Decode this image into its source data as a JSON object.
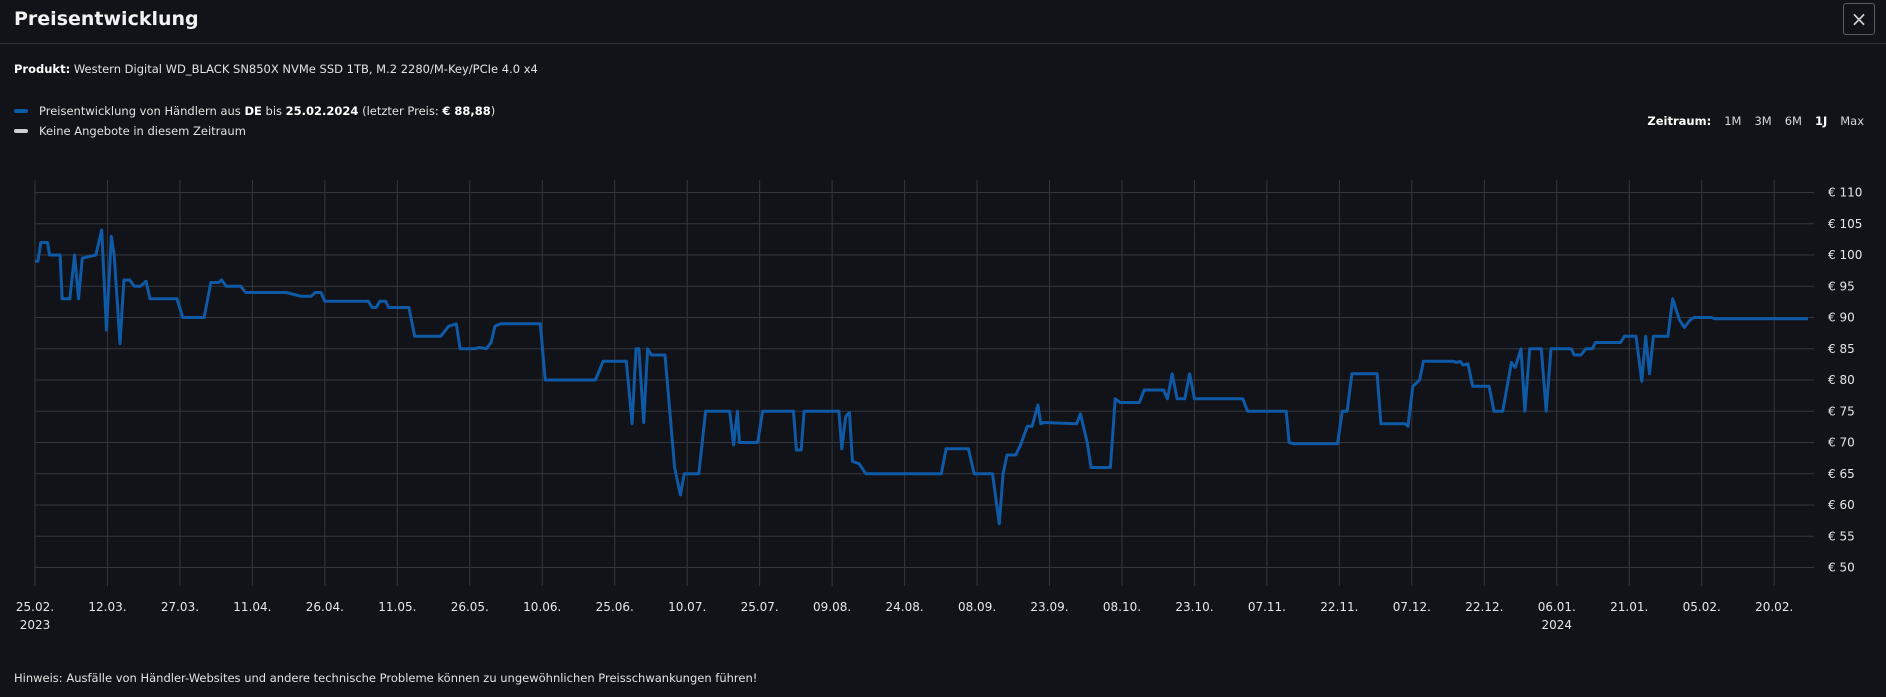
{
  "header": {
    "title": "Preisentwicklung",
    "close_icon": "×"
  },
  "product": {
    "label": "Produkt:",
    "name": "Western Digital WD_BLACK SN850X NVMe SSD 1TB, M.2 2280/M-Key/PCIe 4.0 x4"
  },
  "legend": {
    "text1": "Preisentwicklung von Händlern aus ",
    "country": "DE",
    "text2": " bis ",
    "date": "25.02.2024",
    "text3": " (letzter Preis: ",
    "last_price": "€ 88,88",
    "text4": ")",
    "no_offers": "Keine Angebote in diesem Zeitraum"
  },
  "range": {
    "label": "Zeitraum:",
    "options": [
      "1M",
      "3M",
      "6M",
      "1J",
      "Max"
    ],
    "active": "1J"
  },
  "note": "Hinweis: Ausfälle von Händler-Websites und andere technische Probleme können zu ungewöhnlichen Preisschwankungen führen!",
  "colors": {
    "line": "#0e5aa7",
    "no_offers": "#d0d0d0",
    "background": "#111318",
    "grid": "#34373e"
  },
  "chart_data": {
    "type": "line",
    "title": "",
    "xlabel": "",
    "ylabel": "",
    "ylim": [
      48,
      112
    ],
    "y_ticks": [
      110,
      105,
      100,
      95,
      90,
      85,
      80,
      75,
      70,
      65,
      60,
      55,
      50
    ],
    "y_tick_labels": [
      "€ 110",
      "€ 105",
      "€ 100",
      "€ 95",
      "€ 90",
      "€ 85",
      "€ 80",
      "€ 75",
      "€ 70",
      "€ 65",
      "€ 60",
      "€ 55",
      "€ 50"
    ],
    "x_range": [
      0,
      367
    ],
    "x_ticks": [
      {
        "day": 0,
        "label": "25.02.",
        "sub": "2023"
      },
      {
        "day": 15,
        "label": "12.03."
      },
      {
        "day": 30,
        "label": "27.03."
      },
      {
        "day": 45,
        "label": "11.04."
      },
      {
        "day": 60,
        "label": "26.04."
      },
      {
        "day": 75,
        "label": "11.05."
      },
      {
        "day": 90,
        "label": "26.05."
      },
      {
        "day": 105,
        "label": "10.06."
      },
      {
        "day": 120,
        "label": "25.06."
      },
      {
        "day": 135,
        "label": "10.07."
      },
      {
        "day": 150,
        "label": "25.07."
      },
      {
        "day": 165,
        "label": "09.08."
      },
      {
        "day": 180,
        "label": "24.08."
      },
      {
        "day": 195,
        "label": "08.09."
      },
      {
        "day": 210,
        "label": "23.09."
      },
      {
        "day": 225,
        "label": "08.10."
      },
      {
        "day": 240,
        "label": "23.10."
      },
      {
        "day": 255,
        "label": "07.11."
      },
      {
        "day": 270,
        "label": "22.11."
      },
      {
        "day": 285,
        "label": "07.12."
      },
      {
        "day": 300,
        "label": "22.12."
      },
      {
        "day": 315,
        "label": "06.01.",
        "sub": "2024"
      },
      {
        "day": 330,
        "label": "21.01."
      },
      {
        "day": 345,
        "label": "05.02."
      },
      {
        "day": 360,
        "label": "20.02."
      }
    ],
    "series": [
      {
        "values": [
          [
            0,
            99
          ],
          [
            0.6,
            99
          ],
          [
            1.2,
            102
          ],
          [
            2.6,
            102
          ],
          [
            3,
            100
          ],
          [
            5.2,
            100
          ],
          [
            5.6,
            93
          ],
          [
            7.2,
            93
          ],
          [
            8.2,
            100
          ],
          [
            9,
            93
          ],
          [
            9.8,
            99.5
          ],
          [
            12.6,
            100
          ],
          [
            13.8,
            104
          ],
          [
            14.8,
            88
          ],
          [
            15.8,
            103
          ],
          [
            16.4,
            100
          ],
          [
            17.6,
            85.8
          ],
          [
            18.4,
            96
          ],
          [
            19.6,
            96
          ],
          [
            20.6,
            95
          ],
          [
            21.8,
            95
          ],
          [
            23,
            95.8
          ],
          [
            23.8,
            93
          ],
          [
            29.4,
            93
          ],
          [
            30.6,
            90
          ],
          [
            35,
            90
          ],
          [
            36.4,
            95.6
          ],
          [
            38,
            95.6
          ],
          [
            38.6,
            96
          ],
          [
            39.6,
            95
          ],
          [
            42.6,
            95
          ],
          [
            43.6,
            94
          ],
          [
            52,
            94
          ],
          [
            55,
            93.4
          ],
          [
            57.2,
            93.4
          ],
          [
            58,
            94
          ],
          [
            59.2,
            94
          ],
          [
            60,
            92.6
          ],
          [
            69,
            92.6
          ],
          [
            69.8,
            91.6
          ],
          [
            70.6,
            91.6
          ],
          [
            71.4,
            92.6
          ],
          [
            72.6,
            92.6
          ],
          [
            73.2,
            91.6
          ],
          [
            77.4,
            91.6
          ],
          [
            78.6,
            87
          ],
          [
            84,
            87
          ],
          [
            85.6,
            88.6
          ],
          [
            87.2,
            89
          ],
          [
            88,
            85
          ],
          [
            91,
            85
          ],
          [
            92,
            85.2
          ],
          [
            93.4,
            85
          ],
          [
            94.4,
            86
          ],
          [
            95.2,
            88.6
          ],
          [
            96.4,
            89
          ],
          [
            104.6,
            89
          ],
          [
            105.6,
            80
          ],
          [
            116,
            80
          ],
          [
            117.6,
            83
          ],
          [
            122.4,
            83
          ],
          [
            123.6,
            73
          ],
          [
            124.4,
            85
          ],
          [
            125,
            85
          ],
          [
            126,
            73.2
          ],
          [
            126.8,
            85
          ],
          [
            127.6,
            84
          ],
          [
            130.4,
            84
          ],
          [
            132.4,
            66
          ],
          [
            133.6,
            61.6
          ],
          [
            134.4,
            65
          ],
          [
            137.4,
            65
          ],
          [
            138.8,
            75
          ],
          [
            143.8,
            75
          ],
          [
            144.6,
            69.6
          ],
          [
            145.4,
            75
          ],
          [
            145.8,
            70
          ],
          [
            149.6,
            70
          ],
          [
            150.6,
            75
          ],
          [
            157,
            75
          ],
          [
            157.6,
            68.8
          ],
          [
            158.6,
            68.8
          ],
          [
            159.2,
            75
          ],
          [
            166.4,
            75
          ],
          [
            167,
            69
          ],
          [
            167.8,
            74.2
          ],
          [
            168.6,
            74.8
          ],
          [
            169.2,
            67
          ],
          [
            170.6,
            66.6
          ],
          [
            172,
            65
          ],
          [
            187.6,
            65
          ],
          [
            188.6,
            69
          ],
          [
            193.2,
            69
          ],
          [
            194.4,
            65
          ],
          [
            198.2,
            65
          ],
          [
            199.6,
            57
          ],
          [
            200.4,
            65
          ],
          [
            201.2,
            68
          ],
          [
            203,
            68
          ],
          [
            204,
            69.6
          ],
          [
            205.4,
            72.6
          ],
          [
            206.4,
            72.6
          ],
          [
            207.6,
            76
          ],
          [
            208.2,
            73
          ],
          [
            208.8,
            73.2
          ],
          [
            215.6,
            73
          ],
          [
            216.4,
            74.6
          ],
          [
            217.8,
            70
          ],
          [
            218.6,
            66
          ],
          [
            222.6,
            66
          ],
          [
            223.6,
            77
          ],
          [
            224.6,
            76.4
          ],
          [
            228.6,
            76.4
          ],
          [
            229.6,
            78.4
          ],
          [
            233.6,
            78.4
          ],
          [
            234.4,
            77
          ],
          [
            235.4,
            81
          ],
          [
            236.4,
            77
          ],
          [
            238,
            77
          ],
          [
            239,
            81
          ],
          [
            240,
            77
          ],
          [
            250,
            77
          ],
          [
            251,
            75
          ],
          [
            259,
            75
          ],
          [
            259.6,
            70
          ],
          [
            260.6,
            69.8
          ],
          [
            269.6,
            69.8
          ],
          [
            270.6,
            75
          ],
          [
            271.6,
            75
          ],
          [
            272.6,
            81
          ],
          [
            277.8,
            81
          ],
          [
            278.6,
            73
          ],
          [
            283.6,
            73
          ],
          [
            284.2,
            72.6
          ],
          [
            285.2,
            79
          ],
          [
            286.6,
            80
          ],
          [
            287.4,
            83
          ],
          [
            293.6,
            83
          ],
          [
            294.2,
            82.8
          ],
          [
            295,
            83
          ],
          [
            295.6,
            82.4
          ],
          [
            296.6,
            82.6
          ],
          [
            297.6,
            79
          ],
          [
            301,
            79
          ],
          [
            302,
            75
          ],
          [
            303.8,
            75
          ],
          [
            305.6,
            82.8
          ],
          [
            306.4,
            82
          ],
          [
            307.6,
            85
          ],
          [
            308.4,
            75
          ],
          [
            309.4,
            85
          ],
          [
            311.8,
            85
          ],
          [
            312.8,
            75
          ],
          [
            313.8,
            85
          ],
          [
            318,
            85
          ],
          [
            318.6,
            84
          ],
          [
            320,
            84
          ],
          [
            321,
            85
          ],
          [
            322.4,
            85
          ],
          [
            323,
            86
          ],
          [
            328.2,
            86
          ],
          [
            329,
            87
          ],
          [
            331.4,
            87
          ],
          [
            332.6,
            79.8
          ],
          [
            333.4,
            87
          ],
          [
            334.2,
            81
          ],
          [
            335,
            87
          ],
          [
            338,
            87
          ],
          [
            339,
            93
          ],
          [
            340.4,
            89.6
          ],
          [
            341.4,
            88.4
          ],
          [
            342.6,
            89.6
          ],
          [
            343.4,
            90
          ],
          [
            347,
            90
          ],
          [
            347.8,
            89.8
          ],
          [
            367,
            89.8
          ]
        ]
      }
    ],
    "legend_position": "top-left",
    "grid": true
  }
}
